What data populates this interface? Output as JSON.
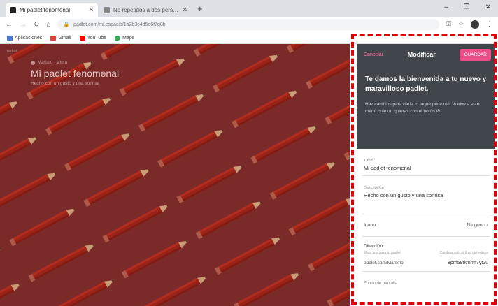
{
  "browser": {
    "tabs": [
      {
        "title": "Mi padlet fenomenal"
      },
      {
        "title": "No repetidos a dos personas"
      }
    ],
    "new_tab": "+",
    "window_controls": [
      "–",
      "❐",
      "✕"
    ],
    "url": "padlet.com/mi.espacio/1a2b3c4d5e6f7g8h",
    "bookmarks": [
      {
        "label": "Aplicaciones",
        "icon": "apps-icon",
        "color": "#4a7bd0"
      },
      {
        "label": "Gmail",
        "icon": "gmail-icon",
        "color": "#d44638"
      },
      {
        "label": "YouTube",
        "icon": "youtube-icon",
        "color": "#ff0000"
      },
      {
        "label": "Maps",
        "icon": "maps-icon",
        "color": "#34a853"
      }
    ]
  },
  "board": {
    "corner": "padlet",
    "author": "Marcelo · ahora",
    "title": "Mi padlet fenomenal",
    "description": "Hecho con un gusto y una sonrisa",
    "background_color": "#7b2a2a"
  },
  "panel": {
    "cancel_label": "Cancelar",
    "title": "Modificar",
    "save_label": "GUARDAR",
    "welcome_heading": "Te damos la bienvenida a tu nuevo y maravilloso padlet.",
    "welcome_text": "Haz cambios para darle tu toque personal. Vuelve a este menú cuando quieras con el botón ⚙.",
    "fields": {
      "title_label": "Título",
      "title_value": "Mi padlet fenomenal",
      "description_label": "Descripción",
      "description_value": "Hecho con un gusto y una sonrisa"
    },
    "icon_row": {
      "label": "Icono",
      "value": "Ninguno ›"
    },
    "address": {
      "label": "Dirección",
      "sub_left": "Elige una para tu padlet",
      "sub_right": "Cambiar solo el final del enlace",
      "prefix": "padlet.com/Marcelo",
      "slug": "8pm58tkmrm7yt2u"
    },
    "next_section": "Fondo de pantalla",
    "accent_color": "#ea4f8a"
  }
}
